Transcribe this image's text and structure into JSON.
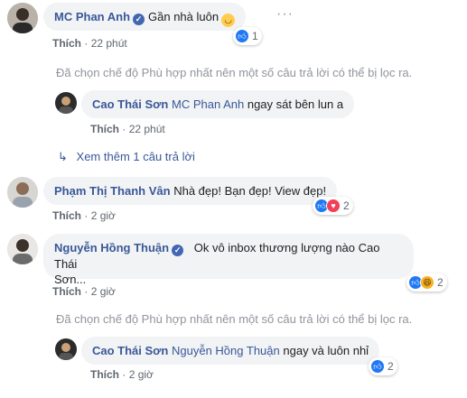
{
  "comments": [
    {
      "author": "MC Phan Anh",
      "text": "Gần nhà luôn",
      "emoji": "smiling-face",
      "like_label": "Thích",
      "time": "22 phút",
      "reaction_count": "1"
    },
    {
      "author": "Cao Thái Sơn",
      "mention": "MC Phan Anh",
      "text": "ngay sát bên lun a",
      "like_label": "Thích",
      "time": "22 phút"
    },
    {
      "author": "Phạm Thị Thanh Vân",
      "text": "Nhà đẹp! Bạn đẹp! View đẹp!",
      "like_label": "Thích",
      "time": "2 giờ",
      "reaction_count": "2"
    },
    {
      "author": "Nguyễn Hồng Thuận",
      "text_line1": "Ok vô inbox thương lượng nào Cao Thái",
      "text_line2": "Sơn...",
      "like_label": "Thích",
      "time": "2 giờ",
      "reaction_count": "2"
    },
    {
      "author": "Cao Thái Sơn",
      "mention": "Nguyễn Hồng Thuận",
      "text": "ngay và luôn nhỉ",
      "like_label": "Thích",
      "time": "2 giờ",
      "reaction_count": "2"
    }
  ],
  "filter_notice": "Đã chọn chế độ Phù hợp nhất nên một số câu trả lời có thể bị lọc ra.",
  "view_more": "Xem thêm 1 câu trả lời",
  "separator": "·",
  "more_dots": "···",
  "icons": [
    "verified-badge-icon",
    "like-reaction-icon",
    "love-reaction-icon",
    "haha-reaction-icon",
    "reply-arrow-icon",
    "more-options-icon"
  ],
  "colors": {
    "name": "#385898",
    "bubble": "#f2f3f5",
    "meta": "#606770",
    "notice": "#90949c",
    "like": "#2078f4",
    "love": "#f33e58"
  }
}
